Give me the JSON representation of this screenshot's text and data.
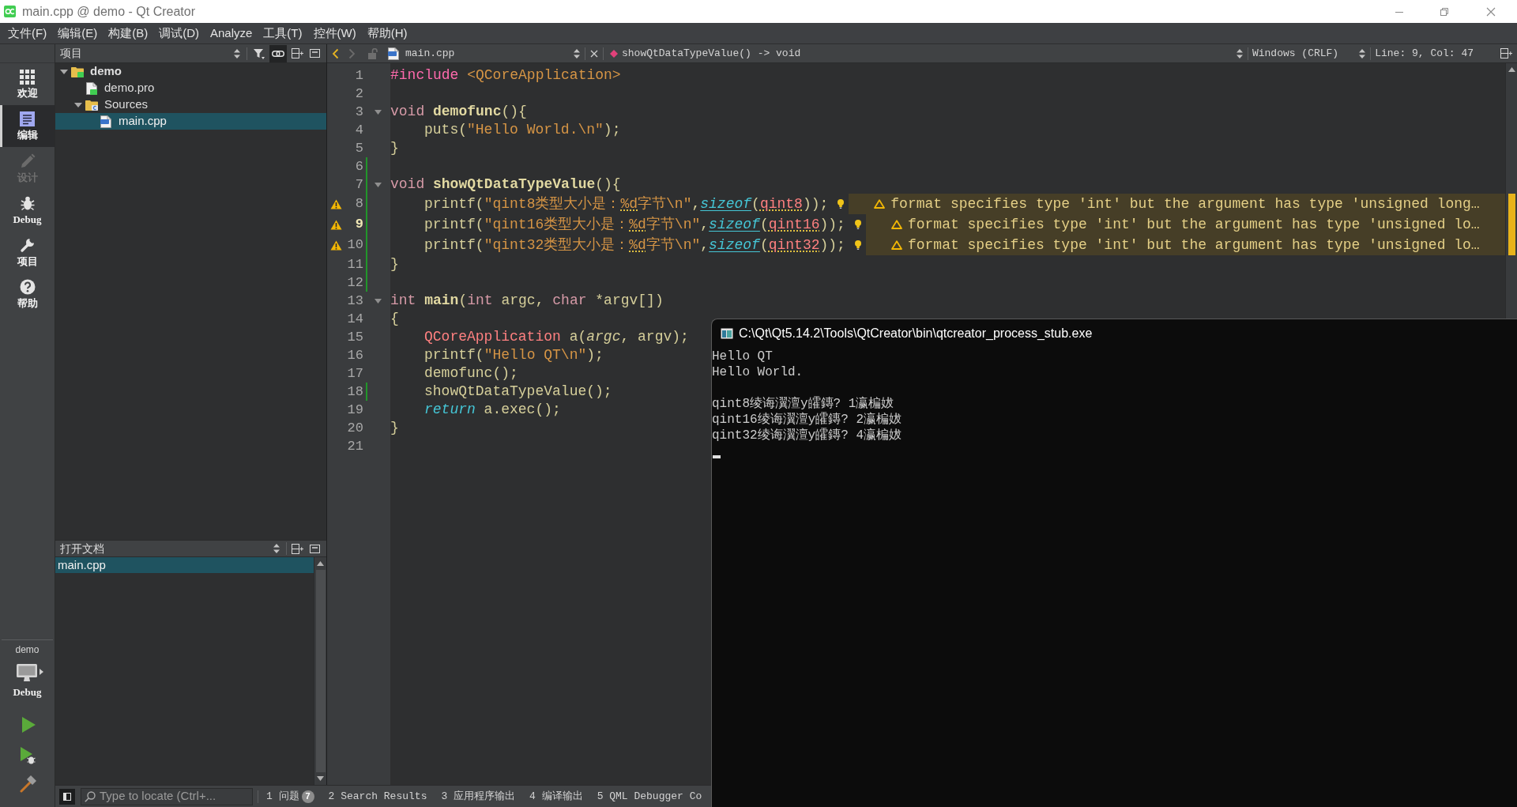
{
  "window": {
    "title": "main.cpp @ demo - Qt Creator"
  },
  "menu": [
    "文件(F)",
    "编辑(E)",
    "构建(B)",
    "调试(D)",
    "Analyze",
    "工具(T)",
    "控件(W)",
    "帮助(H)"
  ],
  "modes": [
    {
      "label": "欢迎",
      "selected": false,
      "disabled": false
    },
    {
      "label": "编辑",
      "selected": true,
      "disabled": false
    },
    {
      "label": "设计",
      "selected": false,
      "disabled": true
    },
    {
      "label": "Debug",
      "selected": false,
      "disabled": false
    },
    {
      "label": "项目",
      "selected": false,
      "disabled": false
    },
    {
      "label": "帮助",
      "selected": false,
      "disabled": false
    }
  ],
  "kit": {
    "project": "demo",
    "build": "Debug"
  },
  "project_panel": {
    "title": "项目",
    "sync_with_editor": true,
    "tree": [
      {
        "label": "demo",
        "kind": "project",
        "expanded": true,
        "selected": false,
        "children": [
          {
            "label": "demo.pro",
            "kind": "pro",
            "selected": false
          },
          {
            "label": "Sources",
            "kind": "folder",
            "expanded": true,
            "selected": false,
            "children": [
              {
                "label": "main.cpp",
                "kind": "cpp",
                "selected": true
              }
            ]
          }
        ]
      }
    ]
  },
  "open_documents": {
    "title": "打开文档",
    "items": [
      {
        "label": "main.cpp",
        "selected": true
      }
    ]
  },
  "editor": {
    "toolbar": {
      "back_enabled": true,
      "forward_enabled": false,
      "file": "main.cpp",
      "symbol": "showQtDataTypeValue() -> void",
      "line_ending": "Windows (CRLF)",
      "position": "Line: 9, Col: 47"
    },
    "lines": [
      {
        "number": "1",
        "indented": false,
        "fold": false,
        "changed": false,
        "current": false,
        "tokens": [
          {
            "text": "#include ",
            "kind": "preproc"
          },
          {
            "text": "<QCoreApplication>",
            "kind": "include"
          }
        ]
      },
      {
        "number": "2",
        "fold": false,
        "changed": false,
        "current": false
      },
      {
        "number": "3",
        "indented": false,
        "fold": true,
        "changed": false,
        "current": false,
        "tokens": [
          {
            "text": "void ",
            "kind": "keyword"
          },
          {
            "text": "demofunc",
            "kind": "declaration"
          },
          {
            "text": "(){",
            "kind": "plain"
          }
        ]
      },
      {
        "number": "4",
        "indented": true,
        "fold": false,
        "changed": false,
        "current": false,
        "tokens": [
          {
            "text": "puts(",
            "kind": "plain"
          },
          {
            "text": "\"Hello World.\\n\"",
            "kind": "string"
          },
          {
            "text": ");",
            "kind": "plain"
          }
        ]
      },
      {
        "number": "5",
        "indented": false,
        "fold": false,
        "changed": false,
        "current": false,
        "tokens": [
          {
            "text": "}",
            "kind": "plain"
          }
        ]
      },
      {
        "number": "6",
        "fold": false,
        "changed": true,
        "current": false
      },
      {
        "number": "7",
        "indented": false,
        "fold": true,
        "changed": true,
        "current": false,
        "tokens": [
          {
            "text": "void ",
            "kind": "keyword"
          },
          {
            "text": "showQtDataTypeValue",
            "kind": "declaration"
          },
          {
            "text": "(){",
            "kind": "plain"
          }
        ]
      },
      {
        "number": "8",
        "indented": true,
        "fold": false,
        "changed": true,
        "current": false,
        "tokens": [
          {
            "text": "printf(",
            "kind": "plain"
          },
          {
            "text": "\"qint8类型大小是：",
            "kind": "string"
          },
          {
            "text": "%d",
            "kind": "flagged_string"
          },
          {
            "text": "字节\\n\"",
            "kind": "string"
          },
          {
            "text": ",",
            "kind": "plain"
          },
          {
            "text": "sizeof",
            "kind": "builtin"
          },
          {
            "text": "(",
            "kind": "plain"
          },
          {
            "text": "qint8",
            "kind": "flagged_type"
          },
          {
            "text": "));",
            "kind": "plain"
          }
        ],
        "warning": {
          "text": "format specifies type 'int' but the argument has type 'unsigned long…"
        }
      },
      {
        "number": "9",
        "indented": true,
        "fold": false,
        "changed": true,
        "current": true,
        "tokens": [
          {
            "text": "printf(",
            "kind": "plain"
          },
          {
            "text": "\"qint16类型大小是：",
            "kind": "string"
          },
          {
            "text": "%d",
            "kind": "flagged_string"
          },
          {
            "text": "字节\\n\"",
            "kind": "string"
          },
          {
            "text": ",",
            "kind": "plain"
          },
          {
            "text": "sizeof",
            "kind": "builtin"
          },
          {
            "text": "(",
            "kind": "plain"
          },
          {
            "text": "qint16",
            "kind": "flagged_type"
          },
          {
            "text": "));",
            "kind": "plain"
          }
        ],
        "warning": {
          "text": "format specifies type 'int' but the argument has type 'unsigned lo…"
        }
      },
      {
        "number": "10",
        "indented": true,
        "fold": false,
        "changed": true,
        "current": false,
        "tokens": [
          {
            "text": "printf(",
            "kind": "plain"
          },
          {
            "text": "\"qint32类型大小是：",
            "kind": "string"
          },
          {
            "text": "%d",
            "kind": "flagged_string"
          },
          {
            "text": "字节\\n\"",
            "kind": "string"
          },
          {
            "text": ",",
            "kind": "plain"
          },
          {
            "text": "sizeof",
            "kind": "builtin"
          },
          {
            "text": "(",
            "kind": "plain"
          },
          {
            "text": "qint32",
            "kind": "flagged_type"
          },
          {
            "text": "));",
            "kind": "plain"
          }
        ],
        "warning": {
          "text": "format specifies type 'int' but the argument has type 'unsigned lo…"
        }
      },
      {
        "number": "11",
        "indented": false,
        "fold": false,
        "changed": true,
        "current": false,
        "tokens": [
          {
            "text": "}",
            "kind": "plain"
          }
        ]
      },
      {
        "number": "12",
        "fold": false,
        "changed": true,
        "current": false
      },
      {
        "number": "13",
        "indented": false,
        "fold": true,
        "changed": false,
        "current": false,
        "tokens": [
          {
            "text": "int ",
            "kind": "keyword"
          },
          {
            "text": "main",
            "kind": "declaration"
          },
          {
            "text": "(",
            "kind": "plain"
          },
          {
            "text": "int",
            "kind": "keyword"
          },
          {
            "text": " argc, ",
            "kind": "plain"
          },
          {
            "text": "char",
            "kind": "keyword"
          },
          {
            "text": " *argv[])",
            "kind": "plain"
          }
        ]
      },
      {
        "number": "14",
        "indented": false,
        "fold": false,
        "changed": false,
        "current": false,
        "tokens": [
          {
            "text": "{",
            "kind": "plain"
          }
        ]
      },
      {
        "number": "15",
        "indented": true,
        "fold": false,
        "changed": false,
        "current": false,
        "tokens": [
          {
            "text": "QCoreApplication",
            "kind": "type"
          },
          {
            "text": " a(",
            "kind": "plain"
          },
          {
            "text": "argc",
            "kind": "param"
          },
          {
            "text": ", argv);",
            "kind": "plain"
          }
        ]
      },
      {
        "number": "16",
        "indented": true,
        "fold": false,
        "changed": false,
        "current": false,
        "tokens": [
          {
            "text": "printf(",
            "kind": "plain"
          },
          {
            "text": "\"Hello QT\\n\"",
            "kind": "string"
          },
          {
            "text": ");",
            "kind": "plain"
          }
        ]
      },
      {
        "number": "17",
        "indented": true,
        "fold": false,
        "changed": false,
        "current": false,
        "tokens": [
          {
            "text": "demofunc();",
            "kind": "plain"
          }
        ]
      },
      {
        "number": "18",
        "indented": true,
        "fold": false,
        "changed": true,
        "current": false,
        "tokens": [
          {
            "text": "showQtDataTypeValue();",
            "kind": "plain"
          }
        ]
      },
      {
        "number": "19",
        "indented": true,
        "fold": false,
        "changed": false,
        "current": false,
        "tokens": [
          {
            "text": "return",
            "kind": "flow"
          },
          {
            "text": " a.exec();",
            "kind": "plain"
          }
        ]
      },
      {
        "number": "20",
        "indented": false,
        "fold": false,
        "changed": false,
        "current": false,
        "tokens": [
          {
            "text": "}",
            "kind": "plain"
          }
        ]
      },
      {
        "number": "21",
        "fold": false,
        "changed": false,
        "current": false
      }
    ]
  },
  "status_bar": {
    "locate": {
      "placeholder": "Type to locate (Ctrl+..."
    },
    "panes": [
      {
        "label": "1 问题",
        "badge": "7"
      },
      {
        "label": "2 Search Results"
      },
      {
        "label": "3 应用程序输出"
      },
      {
        "label": "4 编译输出"
      },
      {
        "label": "5 QML Debugger Co"
      }
    ]
  },
  "console": {
    "title": "C:\\Qt\\Qt5.14.2\\Tools\\QtCreator\\bin\\qtcreator_process_stub.exe",
    "blocks": [
      [
        "Hello QT",
        "Hello World."
      ],
      [
        "qint8绫诲瀷澶у皬鏄? 1瀛楄妭",
        "qint16绫诲瀷澶у皬鏄? 2瀛楄妭",
        "qint32绫诲瀷澶у皬鏄? 4瀛楄妭"
      ]
    ],
    "cursor": true
  }
}
